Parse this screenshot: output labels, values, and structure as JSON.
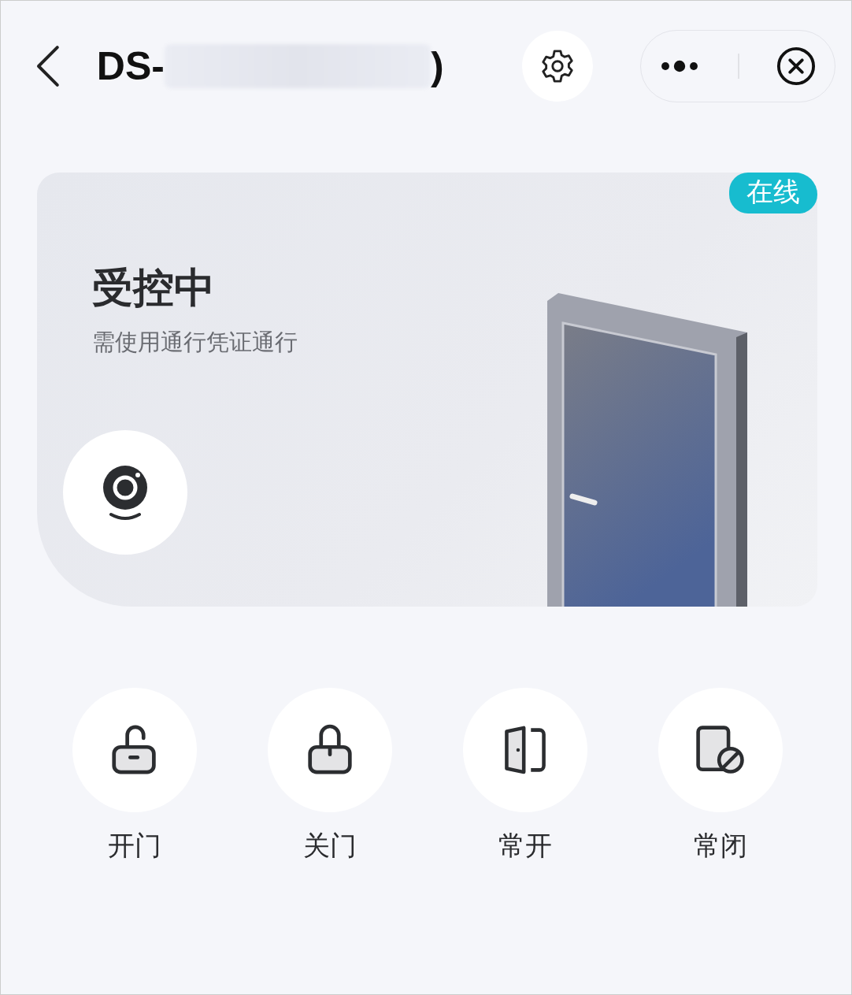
{
  "header": {
    "title_prefix": "DS-",
    "title_suffix": ")"
  },
  "device": {
    "online_badge": "在线",
    "status": "受控中",
    "status_note": "需使用通行凭证通行"
  },
  "actions": [
    {
      "kind": "unlock",
      "label": "开门"
    },
    {
      "kind": "lock",
      "label": "关门"
    },
    {
      "kind": "always-open",
      "label": "常开"
    },
    {
      "kind": "always-closed",
      "label": "常闭"
    }
  ]
}
